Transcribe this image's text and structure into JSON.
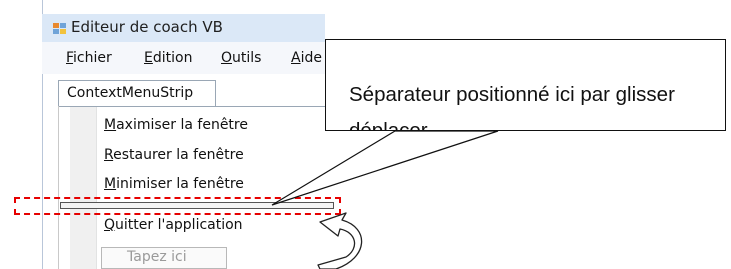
{
  "window": {
    "title": "Editeur de coach VB",
    "icon": "application-form-icon"
  },
  "menubar": {
    "items": [
      "Fichier",
      "Edition",
      "Outils",
      "Aide"
    ]
  },
  "tab": {
    "label": "ContextMenuStrip"
  },
  "context_menu": {
    "items": [
      "Maximiser la fenêtre",
      "Restaurer la fenêtre",
      "Minimiser la fenêtre",
      "Quitter l'application"
    ],
    "placeholder_item": "Tapez ici"
  },
  "callout": {
    "text": "Séparateur positionné ici par glisser déplacer"
  },
  "colors": {
    "dashed_highlight": "#e60000",
    "titlebar": "#dbe8f7"
  }
}
